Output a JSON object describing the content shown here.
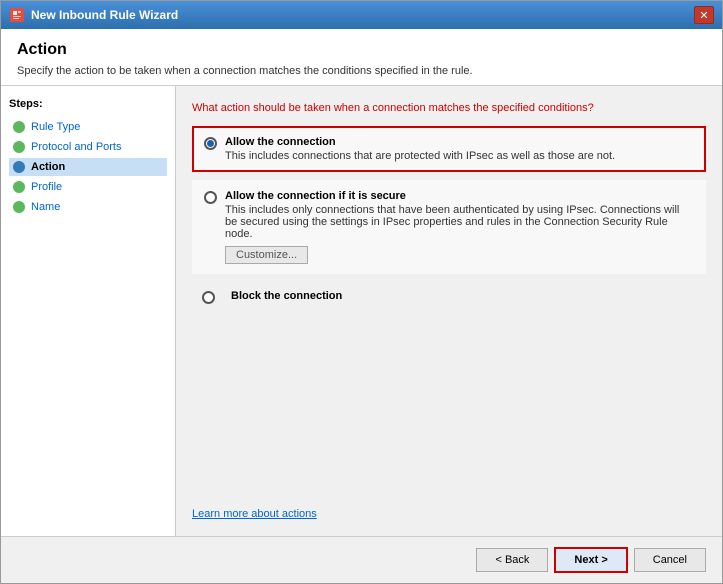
{
  "window": {
    "title": "New Inbound Rule Wizard",
    "close_label": "✕"
  },
  "header": {
    "title": "Action",
    "description": "Specify the action to be taken when a connection matches the conditions specified in the rule."
  },
  "sidebar": {
    "steps_label": "Steps:",
    "items": [
      {
        "id": "rule-type",
        "label": "Rule Type",
        "status": "complete"
      },
      {
        "id": "protocol-ports",
        "label": "Protocol and Ports",
        "status": "complete"
      },
      {
        "id": "action",
        "label": "Action",
        "status": "active"
      },
      {
        "id": "profile",
        "label": "Profile",
        "status": "pending"
      },
      {
        "id": "name",
        "label": "Name",
        "status": "pending"
      }
    ]
  },
  "main": {
    "question": "What action should be taken when a connection matches the specified conditions?",
    "options": [
      {
        "id": "allow",
        "label": "Allow the connection",
        "description": "This includes connections that are protected with IPsec as well as those are not.",
        "selected": true
      },
      {
        "id": "allow-secure",
        "label": "Allow the connection if it is secure",
        "description": "This includes only connections that have been authenticated by using IPsec.  Connections will be secured using the settings in IPsec properties and rules in the Connection Security Rule node.",
        "selected": false,
        "has_customize": true,
        "customize_label": "Customize..."
      },
      {
        "id": "block",
        "label": "Block the connection",
        "selected": false
      }
    ],
    "learn_more_text": "Learn more about actions"
  },
  "footer": {
    "back_label": "< Back",
    "next_label": "Next >",
    "cancel_label": "Cancel"
  }
}
